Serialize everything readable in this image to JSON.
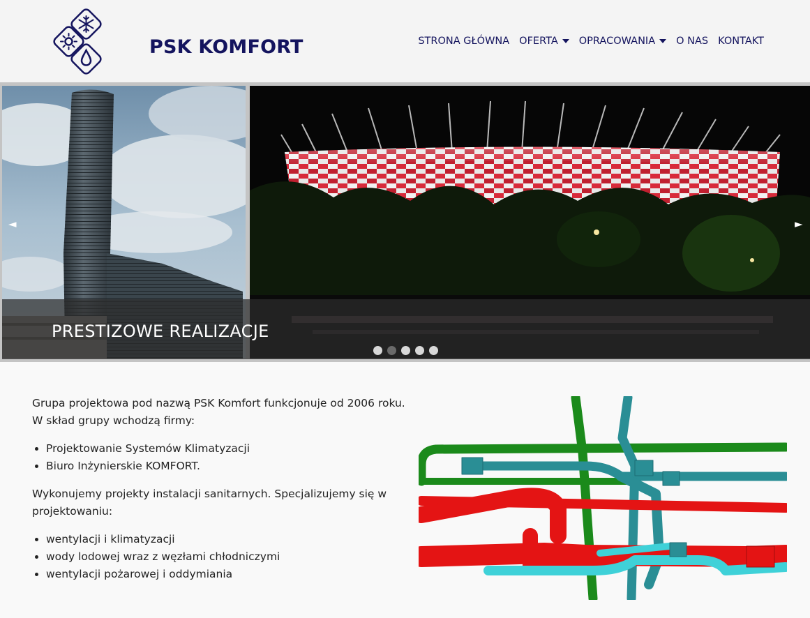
{
  "brand": {
    "name": "PSK KOMFORT"
  },
  "nav": {
    "items": [
      {
        "label": "STRONA GŁÓWNA",
        "dropdown": false
      },
      {
        "label": "OFERTA",
        "dropdown": true
      },
      {
        "label": "OPRACOWANIA",
        "dropdown": true
      },
      {
        "label": "O NAS",
        "dropdown": false
      },
      {
        "label": "KONTAKT",
        "dropdown": false
      }
    ]
  },
  "slider": {
    "caption": "PRESTIZOWE REALIZACJE",
    "prev_icon": "◄",
    "next_icon": "►",
    "dot_count": 5,
    "active_dot": 2
  },
  "content": {
    "intro_line1": "Grupa projektowa pod nazwą PSK Komfort funkcjonuje od 2006 roku.",
    "intro_line2": "W skład grupy wchodzą firmy:",
    "companies": [
      "Projektowanie Systemów Klimatyzacji",
      "Biuro Inżynierskie KOMFORT."
    ],
    "specialization": "Wykonujemy projekty instalacji sanitarnych. Specjalizujemy się w projektowaniu:",
    "services": [
      "wentylacji i klimatyzacji",
      "wody lodowej wraz z węzłami chłodniczymi",
      "wentylacji pożarowej i oddymiania"
    ]
  },
  "colors": {
    "brand_navy": "#14145e",
    "pipe_green": "#1b8a1b",
    "pipe_red": "#e41414",
    "pipe_teal": "#2a8e95",
    "pipe_cyan": "#3fd1d8"
  },
  "icons": {
    "logo_top": "snowflake-icon",
    "logo_left": "sun-icon",
    "logo_bottom": "water-drop-icon"
  }
}
